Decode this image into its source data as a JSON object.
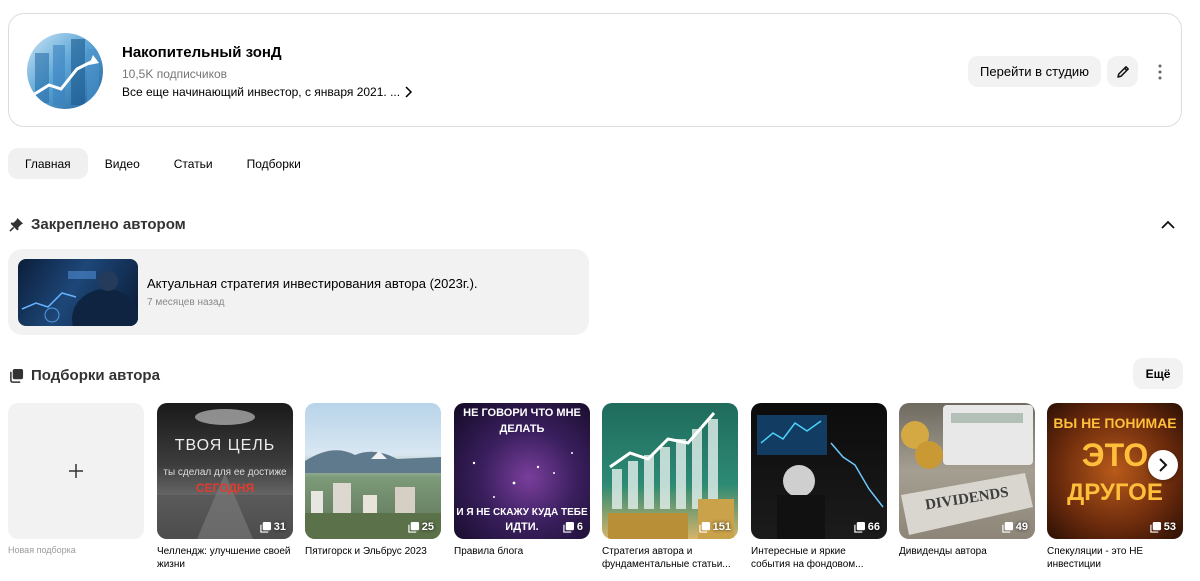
{
  "channel": {
    "title": "Накопительный зонД",
    "subscribers": "10,5K подписчиков",
    "description": "Все еще начинающий инвестор, с января 2021. ...",
    "studio_button": "Перейти в студию"
  },
  "tabs": [
    {
      "label": "Главная"
    },
    {
      "label": "Видео"
    },
    {
      "label": "Статьи"
    },
    {
      "label": "Подборки"
    }
  ],
  "pinned": {
    "heading": "Закреплено автором",
    "item": {
      "title": "Актуальная стратегия инвестирования автора (2023г.).",
      "time": "7 месяцев назад"
    }
  },
  "collections": {
    "heading": "Подборки автора",
    "more_label": "Ещё",
    "new_label": "Новая подборка",
    "items": [
      {
        "title": "Челлендж: улучшение своей жизни",
        "count": "31",
        "overlay": [
          "ТВОЯ ЦЕЛЬ",
          "ты сделал для ее достиже",
          "СЕГОДНЯ"
        ]
      },
      {
        "title": "Пятигорск и Эльбрус 2023",
        "count": "25",
        "overlay": []
      },
      {
        "title": "Правила блога",
        "count": "6",
        "overlay": [
          "НЕ ГОВОРИ ЧТО МНЕ",
          "ДЕЛАТЬ",
          "И Я НЕ СКАЖУ КУДА ТЕБЕ",
          "ИДТИ."
        ]
      },
      {
        "title": "Стратегия автора и фундаментальные статьи...",
        "count": "151",
        "overlay": []
      },
      {
        "title": "Интересные и яркие события на фондовом...",
        "count": "66",
        "overlay": []
      },
      {
        "title": "Дивиденды автора",
        "count": "49",
        "overlay": [
          "DIVIDENDS"
        ]
      },
      {
        "title": "Спекуляции - это НЕ инвестиции",
        "count": "53",
        "overlay": [
          "ВЫ НЕ ПОНИМАЕ",
          "ЭТО",
          "ДРУГОЕ"
        ]
      }
    ]
  },
  "colors": {
    "tile_bg": "#f2f2f2",
    "card_border": "#dcdcdc",
    "muted_text": "#757575"
  }
}
